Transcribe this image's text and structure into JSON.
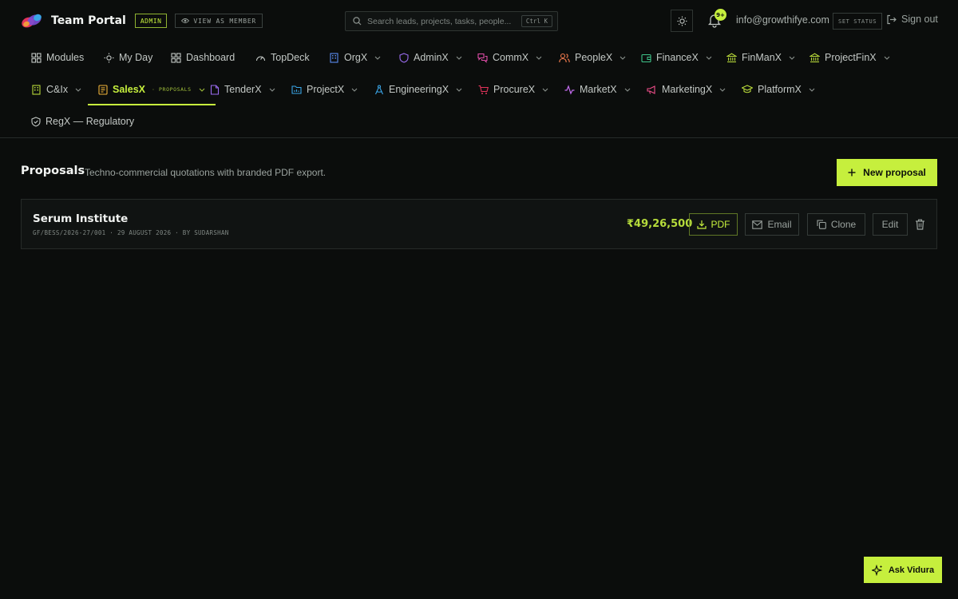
{
  "header": {
    "title": "Team Portal",
    "role_badge": "ADMIN",
    "view_as_member_label": "VIEW AS MEMBER",
    "search": {
      "placeholder": "Search leads, projects, tasks, people...",
      "shortcut": "Ctrl K"
    },
    "notification_count": "9+",
    "user_email": "info@growthifye.com",
    "set_status_label": "SET STATUS",
    "sign_out_label": "Sign out"
  },
  "nav": {
    "row1": [
      {
        "label": "Modules",
        "icon": "grid-icon"
      },
      {
        "label": "My Day",
        "icon": "sun-icon"
      },
      {
        "label": "Dashboard",
        "icon": "grid-icon"
      },
      {
        "label": "TopDeck",
        "icon": "gauge-icon"
      },
      {
        "label": "OrgX",
        "icon": "building-icon"
      },
      {
        "label": "AdminX",
        "icon": "shield-icon"
      },
      {
        "label": "CommX",
        "icon": "chat-icon"
      },
      {
        "label": "PeopleX",
        "icon": "users-icon"
      },
      {
        "label": "FinanceX",
        "icon": "wallet-icon"
      },
      {
        "label": "FinManX",
        "icon": "bank-icon"
      },
      {
        "label": "ProjectFinX",
        "icon": "bank-icon"
      }
    ],
    "row2": [
      {
        "label": "C&Ix",
        "icon": "building-icon"
      },
      {
        "label": "SalesX",
        "icon": "document-icon",
        "sub_label": "PROPOSALS"
      },
      {
        "label": "TenderX",
        "icon": "file-icon"
      },
      {
        "label": "ProjectX",
        "icon": "folder-icon"
      },
      {
        "label": "EngineeringX",
        "icon": "compass-icon"
      },
      {
        "label": "ProcureX",
        "icon": "cart-icon"
      },
      {
        "label": "MarketX",
        "icon": "pulse-icon"
      },
      {
        "label": "MarketingX",
        "icon": "megaphone-icon"
      },
      {
        "label": "PlatformX",
        "icon": "graduation-icon"
      }
    ],
    "row3": [
      {
        "label": "RegX — Regulatory",
        "icon": "shield-check-icon"
      }
    ]
  },
  "page": {
    "title": "Proposals",
    "subtitle": "Techno-commercial quotations with branded PDF export.",
    "new_button_label": "New proposal"
  },
  "proposals": [
    {
      "client": "Serum Institute",
      "meta": "GF/BESS/2026-27/001 · 29 AUGUST 2026 · BY SUDARSHAN",
      "amount": "₹49,26,500",
      "actions": {
        "pdf": "PDF",
        "email": "Email",
        "clone": "Clone",
        "edit": "Edit"
      }
    }
  ],
  "assistant": {
    "label": "Ask Vidura"
  },
  "colors": {
    "accent": "#c6ef3d",
    "background": "#0b0d0c",
    "card": "#101312",
    "border": "#262b29"
  }
}
